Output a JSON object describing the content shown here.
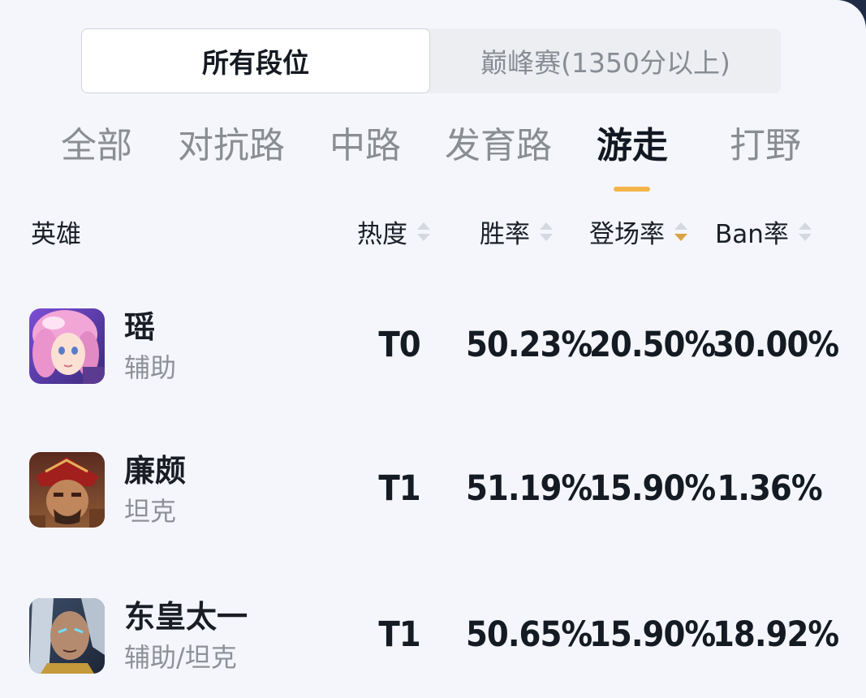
{
  "rank_segment": {
    "options": [
      "所有段位",
      "巅峰赛(1350分以上)"
    ],
    "selected": "所有段位"
  },
  "lane_tabs": {
    "items": [
      "全部",
      "对抗路",
      "中路",
      "发育路",
      "游走",
      "打野"
    ],
    "selected": "游走"
  },
  "table": {
    "headers": {
      "hero": "英雄",
      "heat": "热度",
      "win_rate": "胜率",
      "pick_rate": "登场率",
      "ban_rate": "Ban率"
    },
    "active_sort": "登场率 (descending)",
    "rows": [
      {
        "name": "瑶",
        "role": "辅助",
        "tier": "T0",
        "win_rate": "50.23%",
        "pick_rate": "20.50%",
        "ban_rate": "30.00%"
      },
      {
        "name": "廉颇",
        "role": "坦克",
        "tier": "T1",
        "win_rate": "51.19%",
        "pick_rate": "15.90%",
        "ban_rate": "1.36%"
      },
      {
        "name": "东皇太一",
        "role": "辅助/坦克",
        "tier": "T1",
        "win_rate": "50.65%",
        "pick_rate": "15.90%",
        "ban_rate": "18.92%"
      }
    ]
  },
  "colors": {
    "accent": "#f3b54a",
    "background": "#f5f6fb",
    "text_primary": "#141b22",
    "text_secondary": "#8e9197"
  }
}
